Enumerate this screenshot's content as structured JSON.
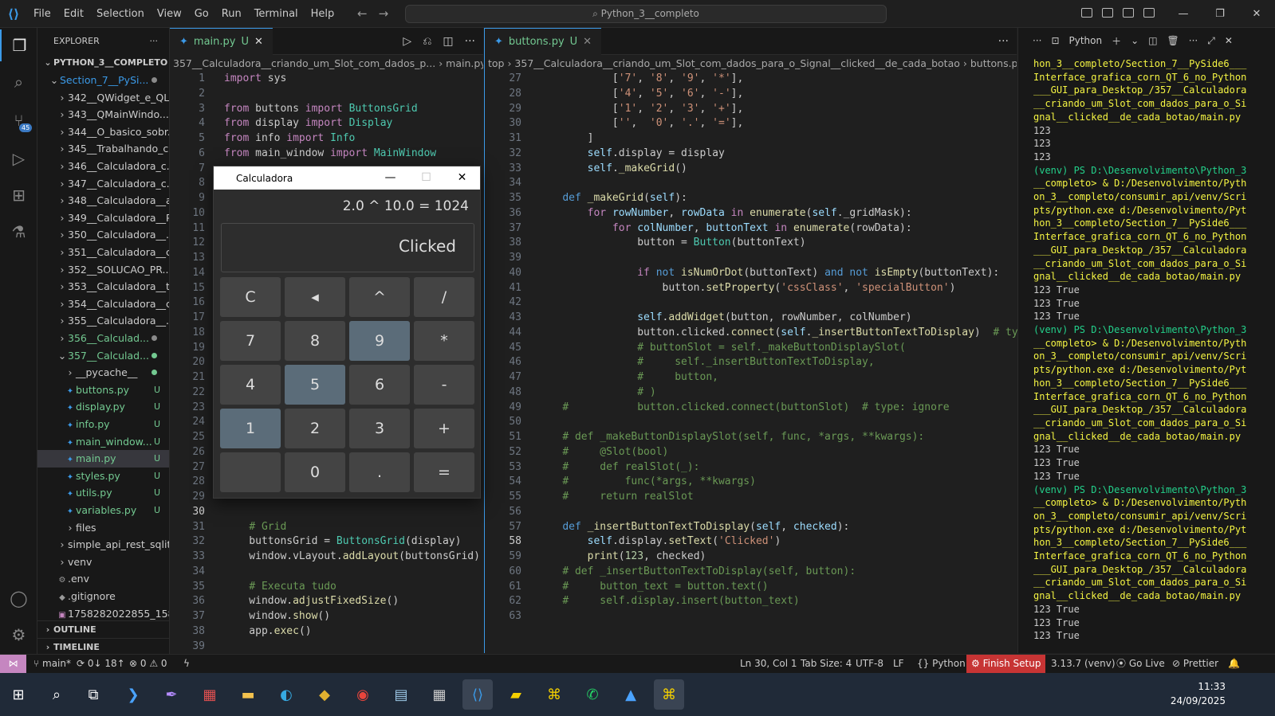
{
  "titlebar": {
    "menus": [
      "File",
      "Edit",
      "Selection",
      "View",
      "Go",
      "Run",
      "Terminal",
      "Help"
    ],
    "search": "Python_3__completo"
  },
  "explorer": {
    "header": "EXPLORER",
    "root": "PYTHON_3__COMPLETO",
    "items": [
      {
        "label": "Section_7__PySi...",
        "indent": 1,
        "arrow": "⌄",
        "color": "blue",
        "dot": "gray"
      },
      {
        "label": "342__QWidget_e_QL...",
        "indent": 2,
        "arrow": "›"
      },
      {
        "label": "343__QMainWindo...",
        "indent": 2,
        "arrow": "›"
      },
      {
        "label": "344__O_basico_sobr...",
        "indent": 2,
        "arrow": "›"
      },
      {
        "label": "345__Trabalhando_c...",
        "indent": 2,
        "arrow": "›"
      },
      {
        "label": "346__Calculadora_c...",
        "indent": 2,
        "arrow": "›"
      },
      {
        "label": "347__Calculadora_c...",
        "indent": 2,
        "arrow": "›"
      },
      {
        "label": "348__Calculadora__a...",
        "indent": 2,
        "arrow": "›"
      },
      {
        "label": "349__Calculadora__P...",
        "indent": 2,
        "arrow": "›"
      },
      {
        "label": "350__Calculadora__...",
        "indent": 2,
        "arrow": "›"
      },
      {
        "label": "351__Calculadora__c...",
        "indent": 2,
        "arrow": "›"
      },
      {
        "label": "352__SOLUCAO_PR...",
        "indent": 2,
        "arrow": "›"
      },
      {
        "label": "353__Calculadora__t...",
        "indent": 2,
        "arrow": "›"
      },
      {
        "label": "354__Calculadora__c...",
        "indent": 2,
        "arrow": "›"
      },
      {
        "label": "355__Calculadora__...",
        "indent": 2,
        "arrow": "›"
      },
      {
        "label": "356__Calculad...",
        "indent": 2,
        "arrow": "›",
        "color": "green",
        "dot": "gray"
      },
      {
        "label": "357__Calculad...",
        "indent": 2,
        "arrow": "⌄",
        "color": "green",
        "dot": "green"
      },
      {
        "label": "__pycache__",
        "indent": 3,
        "arrow": "›",
        "dot": "green"
      },
      {
        "label": "buttons.py",
        "indent": 3,
        "icon": "python",
        "color": "green",
        "status": "U"
      },
      {
        "label": "display.py",
        "indent": 3,
        "icon": "python",
        "color": "green",
        "status": "U"
      },
      {
        "label": "info.py",
        "indent": 3,
        "icon": "python",
        "color": "green",
        "status": "U"
      },
      {
        "label": "main_window...",
        "indent": 3,
        "icon": "python",
        "color": "green",
        "status": "U"
      },
      {
        "label": "main.py",
        "indent": 3,
        "icon": "python",
        "color": "green",
        "status": "U",
        "selected": true
      },
      {
        "label": "styles.py",
        "indent": 3,
        "icon": "python",
        "color": "green",
        "status": "U"
      },
      {
        "label": "utils.py",
        "indent": 3,
        "icon": "python",
        "color": "green",
        "status": "U"
      },
      {
        "label": "variables.py",
        "indent": 3,
        "icon": "python",
        "color": "green",
        "status": "U"
      },
      {
        "label": "files",
        "indent": 3,
        "arrow": "›"
      },
      {
        "label": "simple_api_rest_sqlite...",
        "indent": 2,
        "arrow": "›"
      },
      {
        "label": "venv",
        "indent": 2,
        "arrow": "›"
      },
      {
        "label": ".env",
        "indent": 2,
        "icon": "gear"
      },
      {
        "label": ".gitignore",
        "indent": 2,
        "icon": "git"
      },
      {
        "label": "1758282022855_1588...",
        "indent": 2,
        "icon": "image"
      }
    ],
    "outline": "OUTLINE",
    "timeline": "TIMELINE"
  },
  "editorA": {
    "tab": "main.py",
    "tab_status": "U",
    "breadcrumb": "357__Calculadora__criando_um_Slot_com_dados_p...  ›  main.py  ›  ...",
    "lines": [
      {
        "n": "1",
        "html": "<span class='kw'>import</span> sys"
      },
      {
        "n": "2",
        "html": ""
      },
      {
        "n": "3",
        "html": "<span class='kw'>from</span> buttons <span class='kw'>import</span> <span class='cls'>ButtonsGrid</span>"
      },
      {
        "n": "4",
        "html": "<span class='kw'>from</span> display <span class='kw'>import</span> <span class='cls'>Display</span>"
      },
      {
        "n": "5",
        "html": "<span class='kw'>from</span> info <span class='kw'>import</span> <span class='cls'>Info</span>"
      },
      {
        "n": "6",
        "html": "<span class='kw'>from</span> main_window <span class='kw'>import</span> <span class='cls'>MainWindow</span>"
      },
      {
        "n": "7",
        "html": ""
      },
      {
        "n": "8",
        "html": ""
      },
      {
        "n": "9",
        "html": ""
      },
      {
        "n": "10",
        "html": ""
      },
      {
        "n": "11",
        "html": ""
      },
      {
        "n": "12",
        "html": ""
      },
      {
        "n": "13",
        "html": ""
      },
      {
        "n": "14",
        "html": ""
      },
      {
        "n": "15",
        "html": ""
      },
      {
        "n": "16",
        "html": ""
      },
      {
        "n": "17",
        "html": ""
      },
      {
        "n": "18",
        "html": ""
      },
      {
        "n": "19",
        "html": ""
      },
      {
        "n": "20",
        "html": ""
      },
      {
        "n": "21",
        "html": ""
      },
      {
        "n": "22",
        "html": ""
      },
      {
        "n": "23",
        "html": ""
      },
      {
        "n": "24",
        "html": ""
      },
      {
        "n": "25",
        "html": ""
      },
      {
        "n": "26",
        "html": ""
      },
      {
        "n": "27",
        "html": ""
      },
      {
        "n": "28",
        "html": ""
      },
      {
        "n": "29",
        "html": ""
      },
      {
        "n": "30",
        "html": ""
      },
      {
        "n": "31",
        "html": "    <span class='cmt'># Grid</span>"
      },
      {
        "n": "32",
        "html": "    buttonsGrid = <span class='cls'>ButtonsGrid</span>(display)"
      },
      {
        "n": "33",
        "html": "    window.vLayout.<span class='fn'>addLayout</span>(buttonsGrid)"
      },
      {
        "n": "34",
        "html": ""
      },
      {
        "n": "35",
        "html": "    <span class='cmt'># Executa tudo</span>"
      },
      {
        "n": "36",
        "html": "    window.<span class='fn'>adjustFixedSize</span>()"
      },
      {
        "n": "37",
        "html": "    window.<span class='fn'>show</span>()"
      },
      {
        "n": "38",
        "html": "    app.<span class='fn'>exec</span>()"
      },
      {
        "n": "39",
        "html": ""
      }
    ]
  },
  "editorB": {
    "tab": "buttons.py",
    "tab_status": "U",
    "breadcrumb": "top  ›  357__Calculadora__criando_um_Slot_com_dados_para_o_Signal__clicked__de_cada_botao  ›  buttons.py  ›  ...",
    "lines": [
      {
        "n": "27",
        "html": "            [<span class='str'>'7'</span>, <span class='str'>'8'</span>, <span class='str'>'9'</span>, <span class='str'>'*'</span>],"
      },
      {
        "n": "28",
        "html": "            [<span class='str'>'4'</span>, <span class='str'>'5'</span>, <span class='str'>'6'</span>, <span class='str'>'-'</span>],"
      },
      {
        "n": "29",
        "html": "            [<span class='str'>'1'</span>, <span class='str'>'2'</span>, <span class='str'>'3'</span>, <span class='str'>'+'</span>],"
      },
      {
        "n": "30",
        "html": "            [<span class='str'>''</span>,  <span class='str'>'0'</span>, <span class='str'>'.'</span>, <span class='str'>'='</span>],"
      },
      {
        "n": "31",
        "html": "        ]"
      },
      {
        "n": "32",
        "html": "        <span class='var'>self</span>.display = display"
      },
      {
        "n": "33",
        "html": "        <span class='var'>self</span>.<span class='fn'>_makeGrid</span>()"
      },
      {
        "n": "34",
        "html": ""
      },
      {
        "n": "35",
        "html": "    <span class='kb'>def</span> <span class='fn'>_makeGrid</span>(<span class='var'>self</span>):"
      },
      {
        "n": "36",
        "html": "        <span class='kw'>for</span> <span class='var'>rowNumber</span>, <span class='var'>rowData</span> <span class='kw'>in</span> <span class='fn'>enumerate</span>(<span class='var'>self</span>._gridMask):"
      },
      {
        "n": "37",
        "html": "            <span class='kw'>for</span> <span class='var'>colNumber</span>, <span class='var'>buttonText</span> <span class='kw'>in</span> <span class='fn'>enumerate</span>(rowData):"
      },
      {
        "n": "38",
        "html": "                button = <span class='cls'>Button</span>(buttonText)"
      },
      {
        "n": "39",
        "html": ""
      },
      {
        "n": "40",
        "html": "                <span class='kw'>if</span> <span class='kb'>not</span> <span class='fn'>isNumOrDot</span>(buttonText) <span class='kb'>and</span> <span class='kb'>not</span> <span class='fn'>isEmpty</span>(buttonText):"
      },
      {
        "n": "41",
        "html": "                    button.<span class='fn'>setProperty</span>(<span class='str'>'cssClass'</span>, <span class='str'>'specialButton'</span>)"
      },
      {
        "n": "42",
        "html": ""
      },
      {
        "n": "43",
        "html": "                <span class='var'>self</span>.<span class='fn'>addWidget</span>(button, rowNumber, colNumber)"
      },
      {
        "n": "44",
        "html": "                button.clicked.<span class='fn'>connect</span>(<span class='var'>self</span>.<span class='fn'>_insertButtonTextToDisplay</span>)  <span class='cmt'># type:</span>"
      },
      {
        "n": "45",
        "html": "                <span class='cmt'># buttonSlot = self._makeButtonDisplaySlot(</span>"
      },
      {
        "n": "46",
        "html": "                <span class='cmt'>#     self._insertButtonTextToDisplay,</span>"
      },
      {
        "n": "47",
        "html": "                <span class='cmt'>#     button,</span>"
      },
      {
        "n": "48",
        "html": "                <span class='cmt'># )</span>"
      },
      {
        "n": "49",
        "html": "    <span class='cmt'>#           button.clicked.connect(buttonSlot)  # type: ignore</span>"
      },
      {
        "n": "50",
        "html": ""
      },
      {
        "n": "51",
        "html": "    <span class='cmt'># def _makeButtonDisplaySlot(self, func, *args, **kwargs):</span>"
      },
      {
        "n": "52",
        "html": "    <span class='cmt'>#     @Slot(bool)</span>"
      },
      {
        "n": "53",
        "html": "    <span class='cmt'>#     def realSlot(_):</span>"
      },
      {
        "n": "54",
        "html": "    <span class='cmt'>#         func(*args, **kwargs)</span>"
      },
      {
        "n": "55",
        "html": "    <span class='cmt'>#     return realSlot</span>"
      },
      {
        "n": "56",
        "html": ""
      },
      {
        "n": "57",
        "html": "    <span class='kb'>def</span> <span class='fn'>_insertButtonTextToDisplay</span>(<span class='var'>self</span>, <span class='var'>checked</span>):"
      },
      {
        "n": "58",
        "html": "        <span class='var'>self</span>.display.<span class='fn'>setText</span>(<span class='str'>'Clicked'</span>)"
      },
      {
        "n": "59",
        "html": "        <span class='fn'>print</span>(<span class='num'>123</span>, checked)"
      },
      {
        "n": "60",
        "html": "    <span class='cmt'># def _insertButtonTextToDisplay(self, button):</span>"
      },
      {
        "n": "61",
        "html": "    <span class='cmt'>#     button_text = button.text()</span>"
      },
      {
        "n": "62",
        "html": "    <span class='cmt'>#     self.display.insert(button_text)</span>"
      },
      {
        "n": "63",
        "html": ""
      }
    ]
  },
  "terminal": {
    "shell_label": "Python",
    "lines": [
      {
        "t": "hon_3__completo/Section_7__PySide6___",
        "c": "ty"
      },
      {
        "t": "Interface_grafica_corn_QT_6_no_Python",
        "c": "ty"
      },
      {
        "t": "___GUI_para_Desktop_/357__Calculadora",
        "c": "ty"
      },
      {
        "t": "__criando_um_Slot_com_dados_para_o_Si",
        "c": "ty"
      },
      {
        "t": "gnal__clicked__de_cada_botao/main.py",
        "c": "ty"
      },
      {
        "t": "123",
        "c": ""
      },
      {
        "t": "123",
        "c": ""
      },
      {
        "t": "123",
        "c": ""
      },
      {
        "t": "(venv) PS D:\\Desenvolvimento\\Python_3",
        "c": "tg"
      },
      {
        "t": "__completo> & D:/Desenvolvimento/Pyth",
        "c": "ty"
      },
      {
        "t": "on_3__completo/consumir_api/venv/Scri",
        "c": "ty"
      },
      {
        "t": "pts/python.exe d:/Desenvolvimento/Pyt",
        "c": "ty"
      },
      {
        "t": "hon_3__completo/Section_7__PySide6___",
        "c": "ty"
      },
      {
        "t": "Interface_grafica_corn_QT_6_no_Python",
        "c": "ty"
      },
      {
        "t": "___GUI_para_Desktop_/357__Calculadora",
        "c": "ty"
      },
      {
        "t": "__criando_um_Slot_com_dados_para_o_Si",
        "c": "ty"
      },
      {
        "t": "gnal__clicked__de_cada_botao/main.py",
        "c": "ty"
      },
      {
        "t": "123 True",
        "c": ""
      },
      {
        "t": "123 True",
        "c": ""
      },
      {
        "t": "123 True",
        "c": ""
      },
      {
        "t": "(venv) PS D:\\Desenvolvimento\\Python_3",
        "c": "tg"
      },
      {
        "t": "__completo> & D:/Desenvolvimento/Pyth",
        "c": "ty"
      },
      {
        "t": "on_3__completo/consumir_api/venv/Scri",
        "c": "ty"
      },
      {
        "t": "pts/python.exe d:/Desenvolvimento/Pyt",
        "c": "ty"
      },
      {
        "t": "hon_3__completo/Section_7__PySide6___",
        "c": "ty"
      },
      {
        "t": "Interface_grafica_corn_QT_6_no_Python",
        "c": "ty"
      },
      {
        "t": "___GUI_para_Desktop_/357__Calculadora",
        "c": "ty"
      },
      {
        "t": "__criando_um_Slot_com_dados_para_o_Si",
        "c": "ty"
      },
      {
        "t": "gnal__clicked__de_cada_botao/main.py",
        "c": "ty"
      },
      {
        "t": "123 True",
        "c": ""
      },
      {
        "t": "123 True",
        "c": ""
      },
      {
        "t": "123 True",
        "c": ""
      },
      {
        "t": "(venv) PS D:\\Desenvolvimento\\Python_3",
        "c": "tg"
      },
      {
        "t": "__completo> & D:/Desenvolvimento/Pyth",
        "c": "ty"
      },
      {
        "t": "on_3__completo/consumir_api/venv/Scri",
        "c": "ty"
      },
      {
        "t": "pts/python.exe d:/Desenvolvimento/Pyt",
        "c": "ty"
      },
      {
        "t": "hon_3__completo/Section_7__PySide6___",
        "c": "ty"
      },
      {
        "t": "Interface_grafica_corn_QT_6_no_Python",
        "c": "ty"
      },
      {
        "t": "___GUI_para_Desktop_/357__Calculadora",
        "c": "ty"
      },
      {
        "t": "__criando_um_Slot_com_dados_para_o_Si",
        "c": "ty"
      },
      {
        "t": "gnal__clicked__de_cada_botao/main.py",
        "c": "ty"
      },
      {
        "t": "123 True",
        "c": ""
      },
      {
        "t": "123 True",
        "c": ""
      },
      {
        "t": "123 True",
        "c": ""
      }
    ]
  },
  "calculator": {
    "title": "Calculadora",
    "info": "2.0 ^ 10.0 = 1024",
    "display": "Clicked",
    "buttons": [
      {
        "t": "C"
      },
      {
        "t": "◂"
      },
      {
        "t": "^"
      },
      {
        "t": "/"
      },
      {
        "t": "7"
      },
      {
        "t": "8"
      },
      {
        "t": "9",
        "special": true
      },
      {
        "t": "*"
      },
      {
        "t": "4"
      },
      {
        "t": "5",
        "special": true
      },
      {
        "t": "6"
      },
      {
        "t": "-"
      },
      {
        "t": "1",
        "special": true
      },
      {
        "t": "2"
      },
      {
        "t": "3"
      },
      {
        "t": "+"
      },
      {
        "t": ""
      },
      {
        "t": "0"
      },
      {
        "t": "."
      },
      {
        "t": "="
      }
    ]
  },
  "statusbar": {
    "branch": "main*",
    "sync": "0↓ 18↑",
    "problems": "⊗ 0 ⚠ 0",
    "position": "Ln 30, Col 1",
    "tabsize": "Tab Size: 4",
    "encoding": "UTF-8",
    "eol": "LF",
    "language": "Python",
    "finish_setup": "Finish Setup",
    "interpreter": "3.13.7 (venv)",
    "golive": "Go Live",
    "prettier": "Prettier"
  },
  "taskbar": {
    "time": "11:33",
    "date": "24/09/2025"
  },
  "colors": {
    "accent": "#3b9ae8",
    "untracked": "#73c991",
    "calc_special": "#5b6c79",
    "finish_setup": "#c73434"
  }
}
